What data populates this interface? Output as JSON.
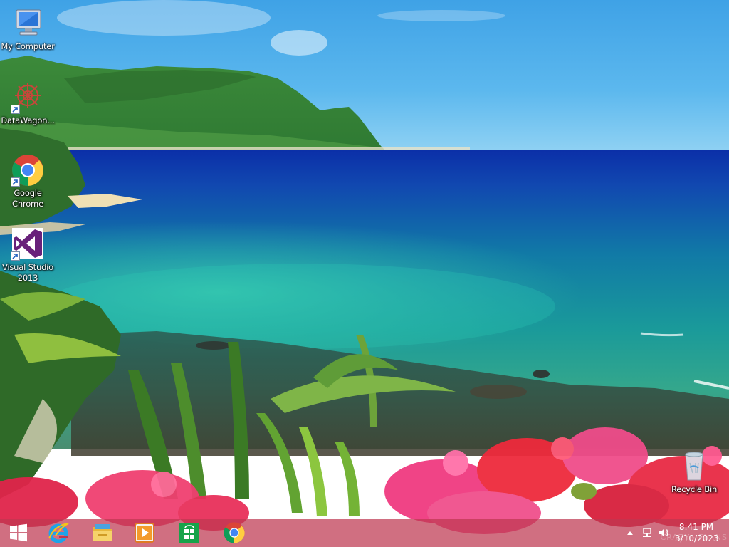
{
  "desktop": {
    "wallpaper": "tropical-coast-with-pink-flowers",
    "icons": [
      {
        "label": "My Computer",
        "icon": "computer-icon"
      },
      {
        "label": "DataWagon...",
        "icon": "datawagon-icon"
      },
      {
        "label": "Google Chrome",
        "icon": "chrome-icon"
      },
      {
        "label": "Visual Studio 2013",
        "icon": "visual-studio-icon"
      },
      {
        "label": "Recycle Bin",
        "icon": "recycle-bin-icon"
      }
    ]
  },
  "taskbar": {
    "pinned": [
      {
        "name": "Start",
        "icon": "windows-logo-icon"
      },
      {
        "name": "Internet Explorer",
        "icon": "internet-explorer-icon"
      },
      {
        "name": "File Explorer",
        "icon": "file-explorer-icon"
      },
      {
        "name": "Windows Media Player",
        "icon": "media-player-icon"
      },
      {
        "name": "Store",
        "icon": "store-icon"
      },
      {
        "name": "Google Chrome",
        "icon": "chrome-icon"
      }
    ],
    "tray": {
      "icons": [
        "show-hidden-icons-icon",
        "network-icon",
        "volume-icon"
      ],
      "time": "8:41 PM",
      "date": "3/10/2023"
    },
    "color": "#be3750"
  },
  "watermark": "CRAZY—FI…NS"
}
